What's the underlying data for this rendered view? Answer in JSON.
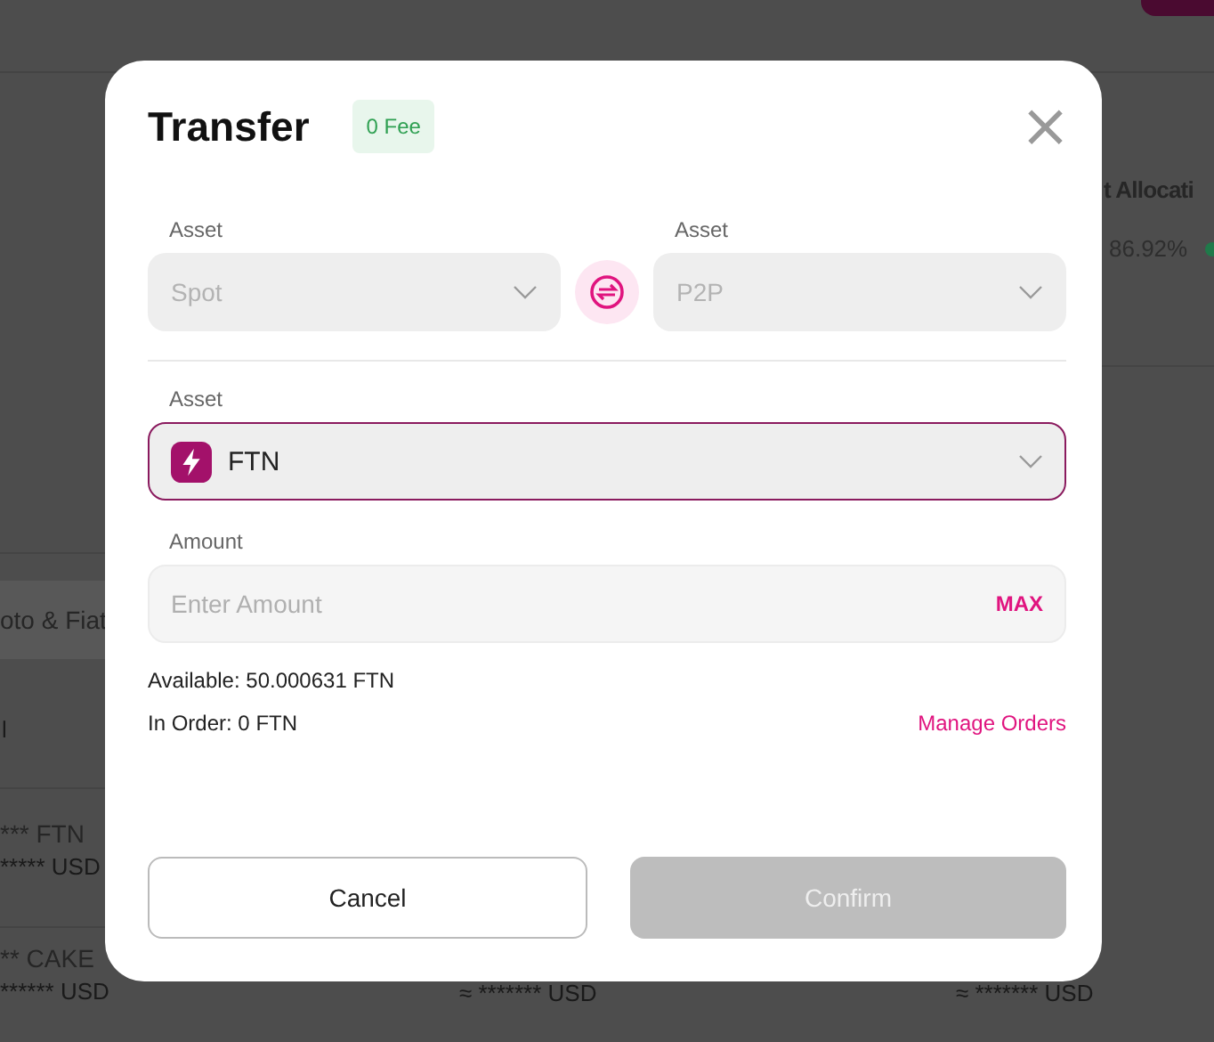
{
  "background": {
    "heading": "t Allocati",
    "percent": "86.92%",
    "filter_tab": "oto & Fiat",
    "column_mark": "l",
    "rows": [
      {
        "amount": "*** FTN",
        "value": "***** USD"
      },
      {
        "amount": "** CAKE",
        "value": "****** USD",
        "values": [
          "≈ ******* USD",
          "≈ ******* USD"
        ]
      }
    ]
  },
  "modal": {
    "title": "Transfer",
    "badge": "0 Fee",
    "close": "×",
    "from": {
      "label": "Asset",
      "value": "Spot",
      "disabled": true
    },
    "to": {
      "label": "Asset",
      "value": "P2P",
      "disabled": true
    },
    "asset": {
      "label": "Asset",
      "value": "FTN",
      "focused": true
    },
    "amount": {
      "label": "Amount",
      "placeholder": "Enter Amount",
      "max": "MAX"
    },
    "available": "Available: 50.000631 FTN",
    "in_order": "In Order: 0 FTN",
    "manage": "Manage Orders",
    "buttons": [
      {
        "label": "Cancel",
        "kind": "secondary",
        "disabled": false
      },
      {
        "label": "Confirm",
        "kind": "primary",
        "disabled": true
      }
    ]
  }
}
